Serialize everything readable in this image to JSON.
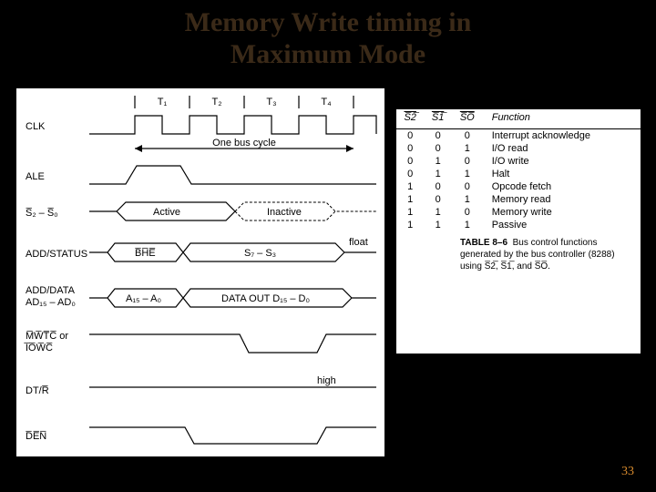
{
  "title_line1": "Memory Write timing in",
  "title_line2": "Maximum Mode",
  "page_number": "33",
  "timing": {
    "t_labels": [
      "T₁",
      "T₂",
      "T₃",
      "T₄"
    ],
    "bus_cycle_label": "One bus cycle",
    "signals": [
      {
        "name": "CLK"
      },
      {
        "name": "ALE"
      },
      {
        "name": "S̅₂ – S̅₀"
      },
      {
        "name": "ADD/STATUS"
      },
      {
        "name_l1": "ADD/DATA",
        "name_l2": "AD₁₅ – AD₀"
      },
      {
        "name_l1": "M̅W̅T̅C̅ or",
        "name_l2": "I̅O̅W̅C̅"
      },
      {
        "name": "DT/R̅"
      },
      {
        "name": "D̅E̅N̅"
      }
    ],
    "labels": {
      "active": "Active",
      "inactive": "Inactive",
      "bhe": "B̅H̅E̅",
      "s7s3": "S₇ – S₃",
      "float": "float",
      "addr": "A₁₅ – A₀",
      "dataout": "DATA OUT D₁₅ – D₀",
      "high": "high"
    }
  },
  "table": {
    "headers": [
      "S̅2̅",
      "S̅1̅",
      "S̅O̅",
      "Function"
    ],
    "rows": [
      [
        "0",
        "0",
        "0",
        "Interrupt acknowledge"
      ],
      [
        "0",
        "0",
        "1",
        "I/O read"
      ],
      [
        "0",
        "1",
        "0",
        "I/O write"
      ],
      [
        "0",
        "1",
        "1",
        "Halt"
      ],
      [
        "1",
        "0",
        "0",
        "Opcode fetch"
      ],
      [
        "1",
        "0",
        "1",
        "Memory read"
      ],
      [
        "1",
        "1",
        "0",
        "Memory write"
      ],
      [
        "1",
        "1",
        "1",
        "Passive"
      ]
    ],
    "caption_label": "TABLE 8–6",
    "caption_text1": "Bus control functions generated by the bus controller (8288) using",
    "caption_text2": "S̅2̅, S̅1̅, and S̅O̅."
  },
  "chart_data": {
    "type": "timing-diagram",
    "title": "Memory Write timing in Maximum Mode (8086/8088, 8288 bus controller)",
    "x_axis": {
      "units": "T-state",
      "ticks": [
        "T1",
        "T2",
        "T3",
        "T4"
      ],
      "span_label": "One bus cycle"
    },
    "signals": [
      {
        "name": "CLK",
        "kind": "clock",
        "pattern": "square wave, 4 cycles across T1–T4"
      },
      {
        "name": "ALE",
        "kind": "pulse",
        "high_during": "T1",
        "low_otherwise": true
      },
      {
        "name": "S2-S0 (active-low status)",
        "kind": "bus",
        "value_T1_T2": "Active",
        "value_T3_T4": "Inactive"
      },
      {
        "name": "ADD/STATUS",
        "kind": "bus",
        "value_T1": "BHE#",
        "value_T2_T4": "S7–S3",
        "after_T4": "float"
      },
      {
        "name": "ADD/DATA AD15–AD0",
        "kind": "bus",
        "value_T1": "A15–A0",
        "value_T2_T4": "DATA OUT D15–D0"
      },
      {
        "name": "MWTC# or IOWC#",
        "kind": "level",
        "level": "high then low during T3, returns high at T4"
      },
      {
        "name": "DT/R#",
        "kind": "level",
        "level": "high (transmit) throughout",
        "label": "high"
      },
      {
        "name": "DEN#",
        "kind": "level",
        "level": "goes low during T2–T3, high otherwise"
      }
    ],
    "status_decode_table": {
      "columns": [
        "S2#",
        "S1#",
        "S0#",
        "Function"
      ],
      "rows": [
        [
          0,
          0,
          0,
          "Interrupt acknowledge"
        ],
        [
          0,
          0,
          1,
          "I/O read"
        ],
        [
          0,
          1,
          0,
          "I/O write"
        ],
        [
          0,
          1,
          1,
          "Halt"
        ],
        [
          1,
          0,
          0,
          "Opcode fetch"
        ],
        [
          1,
          0,
          1,
          "Memory read"
        ],
        [
          1,
          1,
          0,
          "Memory write"
        ],
        [
          1,
          1,
          1,
          "Passive"
        ]
      ]
    }
  }
}
